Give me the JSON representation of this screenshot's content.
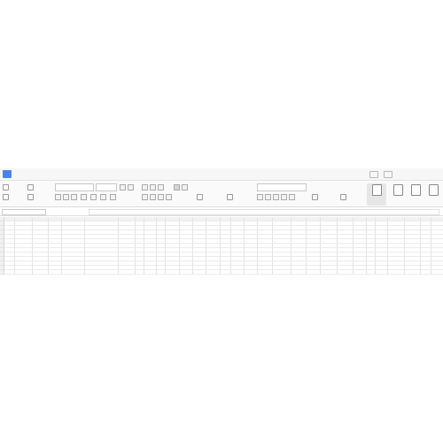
{
  "window": {
    "menu": [
      {
        "label": "",
        "active": false
      },
      {
        "label": "",
        "active": false
      },
      {
        "label": "",
        "active": false
      },
      {
        "label": "",
        "active": true
      },
      {
        "label": "",
        "active": false
      },
      {
        "label": "",
        "active": false
      },
      {
        "label": "",
        "active": false
      },
      {
        "label": "",
        "active": false
      },
      {
        "label": "",
        "active": false
      },
      {
        "label": "",
        "active": false
      },
      {
        "label": "",
        "active": false
      },
      {
        "label": "",
        "active": false
      },
      {
        "label": "",
        "active": false
      },
      {
        "label": "",
        "active": false
      }
    ],
    "right": {
      "search": "",
      "share": "",
      "comment": ""
    }
  },
  "ribbon": {
    "cut": "",
    "copy": "",
    "paste": "",
    "format_painter": "",
    "font_name": "",
    "font_size": "",
    "number_format": "",
    "merge_center": "",
    "wrap_text": "",
    "conditional_format": "",
    "table_style": "",
    "cell_style": "",
    "sum": "",
    "filter": "",
    "sort": "",
    "fill": "",
    "grow_font": "",
    "shrink_font": "",
    "bold": "",
    "italic": "",
    "underline": "",
    "font_color": "",
    "clear": ""
  },
  "formula_bar": {
    "name_box": "",
    "fx": "",
    "value": ""
  },
  "watermark": "",
  "colors": {
    "accent": "#1aa260",
    "header_bg": "#f1f1f1",
    "menubar_bg": "#f7f7f7",
    "ribbon_bg": "#fafafa"
  },
  "grid": {
    "col_headers": [
      "",
      "",
      "",
      "",
      "",
      "",
      "",
      "",
      "",
      "",
      "",
      "",
      "",
      "",
      "",
      "",
      "",
      "",
      "",
      "",
      "",
      "",
      "",
      "",
      "",
      "",
      "",
      "",
      "",
      ""
    ],
    "rows": [
      {
        "n": "",
        "cells": [
          "",
          "",
          "",
          "",
          "",
          "",
          "",
          "",
          "",
          "",
          "",
          "",
          "",
          "",
          "",
          "",
          "",
          "",
          "",
          "",
          "",
          "",
          "",
          "",
          "",
          "",
          "",
          "",
          "",
          ""
        ]
      },
      {
        "n": "",
        "cells": [
          "",
          "",
          "",
          "",
          "",
          "",
          "",
          "",
          "",
          "",
          "",
          "",
          "",
          "",
          "",
          "",
          "",
          "",
          "",
          "",
          "",
          "",
          "",
          "",
          "",
          "",
          "",
          "",
          "",
          ""
        ]
      },
      {
        "n": "",
        "cells": [
          "",
          "",
          "",
          "",
          "",
          "",
          "",
          "",
          "",
          "",
          "",
          "",
          "",
          "",
          "",
          "",
          "",
          "",
          "",
          "",
          "",
          "",
          "",
          "",
          "",
          "",
          "",
          "",
          "",
          ""
        ]
      },
      {
        "n": "",
        "cells": [
          "",
          "",
          "",
          "",
          "",
          "",
          "",
          "",
          "",
          "",
          "",
          "",
          "",
          "",
          "",
          "",
          "",
          "",
          "",
          "",
          "",
          "",
          "",
          "",
          "",
          "",
          "",
          "",
          "",
          ""
        ]
      },
      {
        "n": "",
        "cells": [
          "",
          "",
          "",
          "",
          "",
          "",
          "",
          "",
          "",
          "",
          "",
          "",
          "",
          "",
          "",
          "",
          "",
          "",
          "",
          "",
          "",
          "",
          "",
          "",
          "",
          "",
          "",
          "",
          "",
          ""
        ]
      },
      {
        "n": "",
        "cells": [
          "",
          "",
          "",
          "",
          "",
          "",
          "",
          "",
          "",
          "",
          "",
          "",
          "",
          "",
          "",
          "",
          "",
          "",
          "",
          "",
          "",
          "",
          "",
          "",
          "",
          "",
          "",
          "",
          "",
          ""
        ]
      },
      {
        "n": "",
        "cells": [
          "",
          "",
          "",
          "",
          "",
          "",
          "",
          "",
          "",
          "",
          "",
          "",
          "",
          "",
          "",
          "",
          "",
          "",
          "",
          "",
          "",
          "",
          "",
          "",
          "",
          "",
          "",
          "",
          "",
          ""
        ]
      },
      {
        "n": "",
        "cells": [
          "",
          "",
          "",
          "",
          "",
          "",
          "",
          "",
          "",
          "",
          "",
          "",
          "",
          "",
          "",
          "",
          "",
          "",
          "",
          "",
          "",
          "",
          "",
          "",
          "",
          "",
          "",
          "",
          "",
          ""
        ]
      },
      {
        "n": "",
        "cells": [
          "",
          "",
          "",
          "",
          "",
          "",
          "",
          "",
          "",
          "",
          "",
          "",
          "",
          "",
          "",
          "",
          "",
          "",
          "",
          "",
          "",
          "",
          "",
          "",
          "",
          "",
          "",
          "",
          "",
          ""
        ]
      },
      {
        "n": "",
        "cells": [
          "",
          "",
          "",
          "",
          "",
          "",
          "",
          "",
          "",
          "",
          "",
          "",
          "",
          "",
          "",
          "",
          "",
          "",
          "",
          "",
          "",
          "",
          "",
          "",
          "",
          "",
          "",
          "",
          "",
          ""
        ]
      },
      {
        "n": "",
        "cells": [
          "",
          "",
          "",
          "",
          "",
          "",
          "",
          "",
          "",
          "",
          "",
          "",
          "",
          "",
          "",
          "",
          "",
          "",
          "",
          "",
          "",
          "",
          "",
          "",
          "",
          "",
          "",
          "",
          "",
          ""
        ]
      },
      {
        "n": "",
        "cells": [
          "",
          "",
          "",
          "",
          "",
          "",
          "",
          "",
          "",
          "",
          "",
          "",
          "",
          "",
          "",
          "",
          "",
          "",
          "",
          "",
          "",
          "",
          "",
          "",
          "",
          "",
          "",
          "",
          "",
          ""
        ]
      },
      {
        "n": "",
        "cells": [
          "",
          "",
          "",
          "",
          "",
          "",
          "",
          "",
          "",
          "",
          "",
          "",
          "",
          "",
          "",
          "",
          "",
          "",
          "",
          "",
          "",
          "",
          "",
          "",
          "",
          "",
          "",
          "",
          "",
          ""
        ]
      },
      {
        "n": "",
        "cells": [
          "",
          "",
          "",
          "",
          "",
          "",
          "",
          "",
          "",
          "",
          "",
          "",
          "",
          "",
          "",
          "",
          "",
          "",
          "",
          "",
          "",
          "",
          "",
          "",
          "",
          "",
          "",
          "",
          "",
          ""
        ]
      },
      {
        "n": "",
        "cells": [
          "",
          "",
          "",
          "",
          "",
          "",
          "",
          "",
          "",
          "",
          "",
          "",
          "",
          "",
          "",
          "",
          "",
          "",
          "",
          "",
          "",
          "",
          "",
          "",
          "",
          "",
          "",
          "",
          "",
          ""
        ]
      }
    ]
  }
}
